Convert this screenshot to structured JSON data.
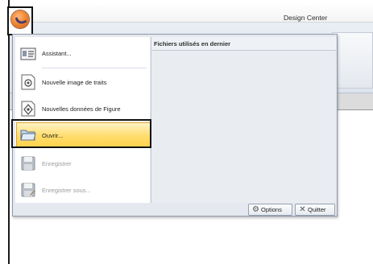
{
  "window": {
    "title": "Design Center"
  },
  "menu": {
    "items": [
      {
        "label": "Assistant...",
        "icon": "assistant-icon",
        "enabled": true
      },
      {
        "label": "Nouvelle image de traits",
        "icon": "new-line-image-icon",
        "enabled": true
      },
      {
        "label": "Nouvelles données de Figure",
        "icon": "new-figure-data-icon",
        "enabled": true
      },
      {
        "label": "Ouvrir...",
        "icon": "open-folder-icon",
        "enabled": true,
        "highlighted": true
      },
      {
        "label": "Enregistrer",
        "icon": "save-icon",
        "enabled": false
      },
      {
        "label": "Enregistrer sous...",
        "icon": "save-as-icon",
        "enabled": false
      }
    ],
    "recent_header": "Fichiers utilisés en dernier",
    "options_label": "Options",
    "quit_label": "Quitter"
  },
  "colors": {
    "highlight": "#ffd24a",
    "app_orb": "#f28a35",
    "menu_bg": "#e5e9ef"
  }
}
